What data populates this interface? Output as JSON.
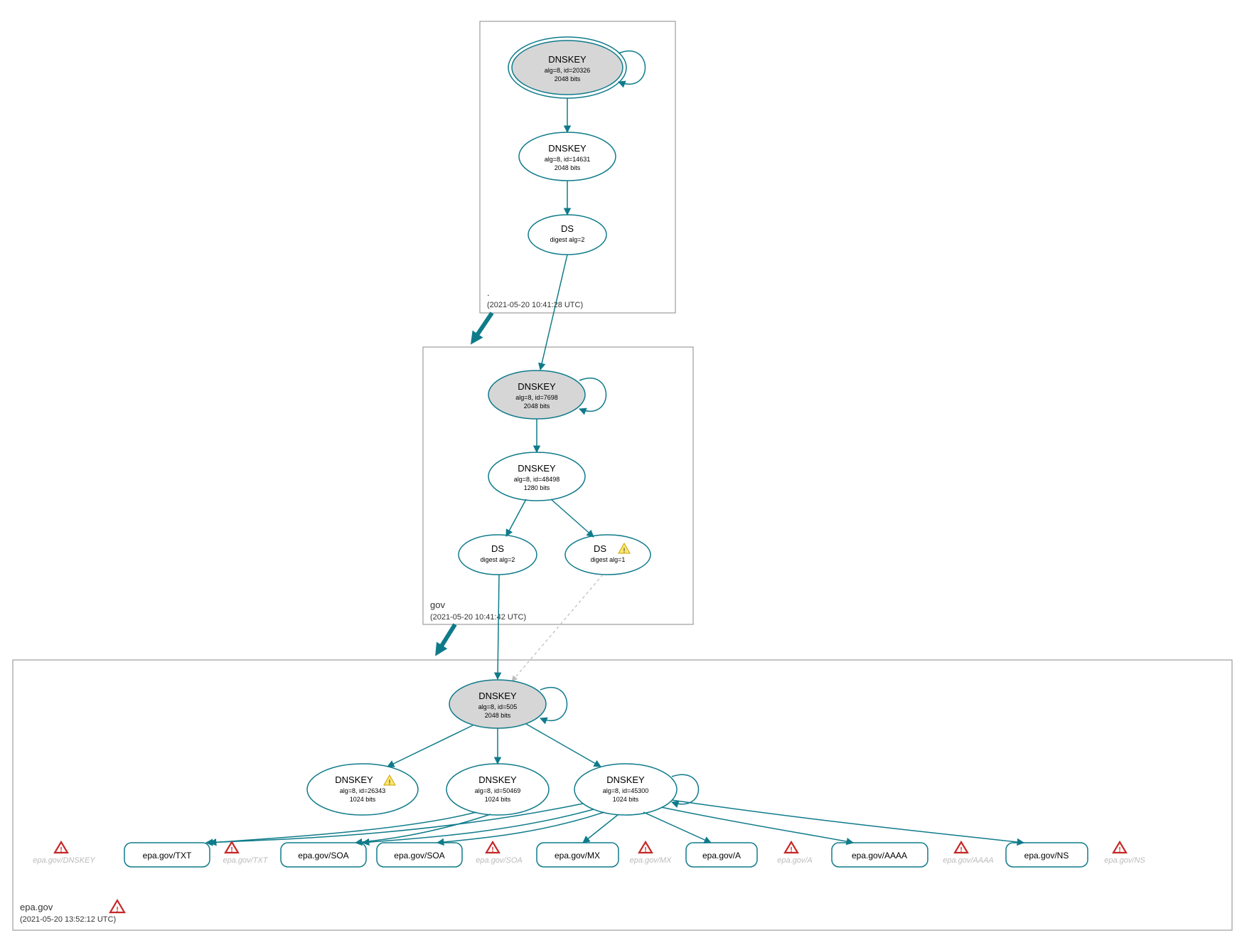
{
  "colors": {
    "teal": "#0f7b8a",
    "node_fill_grey": "#d6d6d6",
    "warn_fill": "#ffe66d",
    "err_stroke": "#c62828"
  },
  "zones": {
    "root": {
      "label": ".",
      "timestamp": "(2021-05-20 10:41:28 UTC)"
    },
    "gov": {
      "label": "gov",
      "timestamp": "(2021-05-20 10:41:42 UTC)"
    },
    "epa": {
      "label": "epa.gov",
      "timestamp": "(2021-05-20 13:52:12 UTC)"
    }
  },
  "root": {
    "ksk": {
      "title": "DNSKEY",
      "sub1": "alg=8, id=20326",
      "sub2": "2048 bits"
    },
    "zsk": {
      "title": "DNSKEY",
      "sub1": "alg=8, id=14631",
      "sub2": "2048 bits"
    },
    "ds": {
      "title": "DS",
      "sub1": "digest alg=2"
    }
  },
  "gov": {
    "ksk": {
      "title": "DNSKEY",
      "sub1": "alg=8, id=7698",
      "sub2": "2048 bits"
    },
    "zsk": {
      "title": "DNSKEY",
      "sub1": "alg=8, id=48498",
      "sub2": "1280 bits"
    },
    "ds1": {
      "title": "DS",
      "sub1": "digest alg=2"
    },
    "ds2": {
      "title": "DS",
      "sub1": "digest alg=1"
    }
  },
  "epa": {
    "ksk": {
      "title": "DNSKEY",
      "sub1": "alg=8, id=505",
      "sub2": "2048 bits"
    },
    "zsk_a": {
      "title": "DNSKEY",
      "sub1": "alg=8, id=26343",
      "sub2": "1024 bits"
    },
    "zsk_b": {
      "title": "DNSKEY",
      "sub1": "alg=8, id=50469",
      "sub2": "1024 bits"
    },
    "zsk_c": {
      "title": "DNSKEY",
      "sub1": "alg=8, id=45300",
      "sub2": "1024 bits"
    }
  },
  "rr": {
    "txt": "epa.gov/TXT",
    "soa1": "epa.gov/SOA",
    "soa2": "epa.gov/SOA",
    "mx": "epa.gov/MX",
    "a": "epa.gov/A",
    "aaaa": "epa.gov/AAAA",
    "ns": "epa.gov/NS"
  },
  "ghost": {
    "dnskey": "epa.gov/DNSKEY",
    "txt": "epa.gov/TXT",
    "soa": "epa.gov/SOA",
    "mx": "epa.gov/MX",
    "a": "epa.gov/A",
    "aaaa": "epa.gov/AAAA",
    "ns": "epa.gov/NS"
  }
}
